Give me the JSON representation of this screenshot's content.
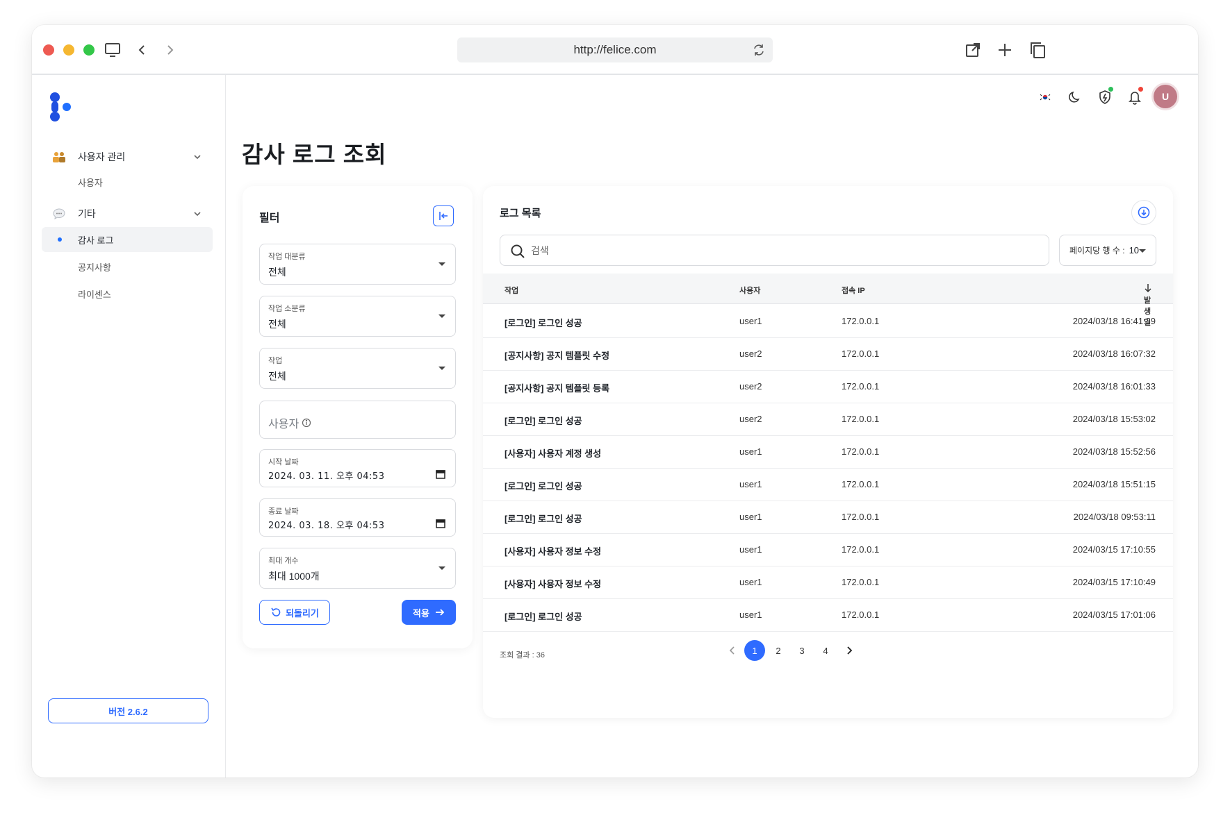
{
  "browser": {
    "url": "http://felice.com"
  },
  "sidebar": {
    "groups": [
      {
        "label": "사용자 관리",
        "icon": "users-icon",
        "items": [
          {
            "label": "사용자"
          }
        ]
      },
      {
        "label": "기타",
        "icon": "chat-icon",
        "items": [
          {
            "label": "감사 로그",
            "active": true
          },
          {
            "label": "공지사항"
          },
          {
            "label": "라이센스"
          }
        ]
      }
    ],
    "version": "버전 2.6.2"
  },
  "header": {
    "avatar_initial": "U"
  },
  "page": {
    "title": "감사 로그 조회"
  },
  "filter": {
    "title": "필터",
    "category": {
      "label": "작업 대분류",
      "value": "전체"
    },
    "subcategory": {
      "label": "작업 소분류",
      "value": "전체"
    },
    "action": {
      "label": "작업",
      "value": "전체"
    },
    "user": {
      "placeholder": "사용자"
    },
    "start_date": {
      "label": "시작 날짜",
      "value": "2024. 03. 11. 오후 04:53"
    },
    "end_date": {
      "label": "종료 날짜",
      "value": "2024. 03. 18. 오후 04:53"
    },
    "max_count": {
      "label": "최대 개수",
      "value": "최대 1000개"
    },
    "reset_label": "되돌리기",
    "apply_label": "적용"
  },
  "logs": {
    "title": "로그 목록",
    "search_placeholder": "검색",
    "rows_per_page_label": "페이지당 행 수 :",
    "rows_per_page_value": "10",
    "columns": [
      "작업",
      "사용자",
      "접속 IP",
      "발생일"
    ],
    "rows": [
      {
        "action": "[로그인] 로그인 성공",
        "user": "user1",
        "ip": "172.0.0.1",
        "date": "2024/03/18 16:41:39"
      },
      {
        "action": "[공지사항] 공지 템플릿 수정",
        "user": "user2",
        "ip": "172.0.0.1",
        "date": "2024/03/18 16:07:32"
      },
      {
        "action": "[공지사항] 공지 템플릿 등록",
        "user": "user2",
        "ip": "172.0.0.1",
        "date": "2024/03/18 16:01:33"
      },
      {
        "action": "[로그인] 로그인 성공",
        "user": "user2",
        "ip": "172.0.0.1",
        "date": "2024/03/18 15:53:02"
      },
      {
        "action": "[사용자] 사용자 계정 생성",
        "user": "user1",
        "ip": "172.0.0.1",
        "date": "2024/03/18 15:52:56"
      },
      {
        "action": "[로그인] 로그인 성공",
        "user": "user1",
        "ip": "172.0.0.1",
        "date": "2024/03/18 15:51:15"
      },
      {
        "action": "[로그인] 로그인 성공",
        "user": "user1",
        "ip": "172.0.0.1",
        "date": "2024/03/18 09:53:11"
      },
      {
        "action": "[사용자] 사용자 정보 수정",
        "user": "user1",
        "ip": "172.0.0.1",
        "date": "2024/03/15 17:10:55"
      },
      {
        "action": "[사용자] 사용자 정보 수정",
        "user": "user1",
        "ip": "172.0.0.1",
        "date": "2024/03/15 17:10:49"
      },
      {
        "action": "[로그인] 로그인 성공",
        "user": "user1",
        "ip": "172.0.0.1",
        "date": "2024/03/15 17:01:06"
      }
    ],
    "result_count_label": "조회 결과 : 36",
    "pages": [
      "1",
      "2",
      "3",
      "4"
    ],
    "current_page": "1"
  },
  "colors": {
    "accent": "#2f6bff",
    "traffic_red": "#ee5a52",
    "traffic_yellow": "#f5b731",
    "traffic_green": "#33c748",
    "avatar": "#c07a86"
  }
}
